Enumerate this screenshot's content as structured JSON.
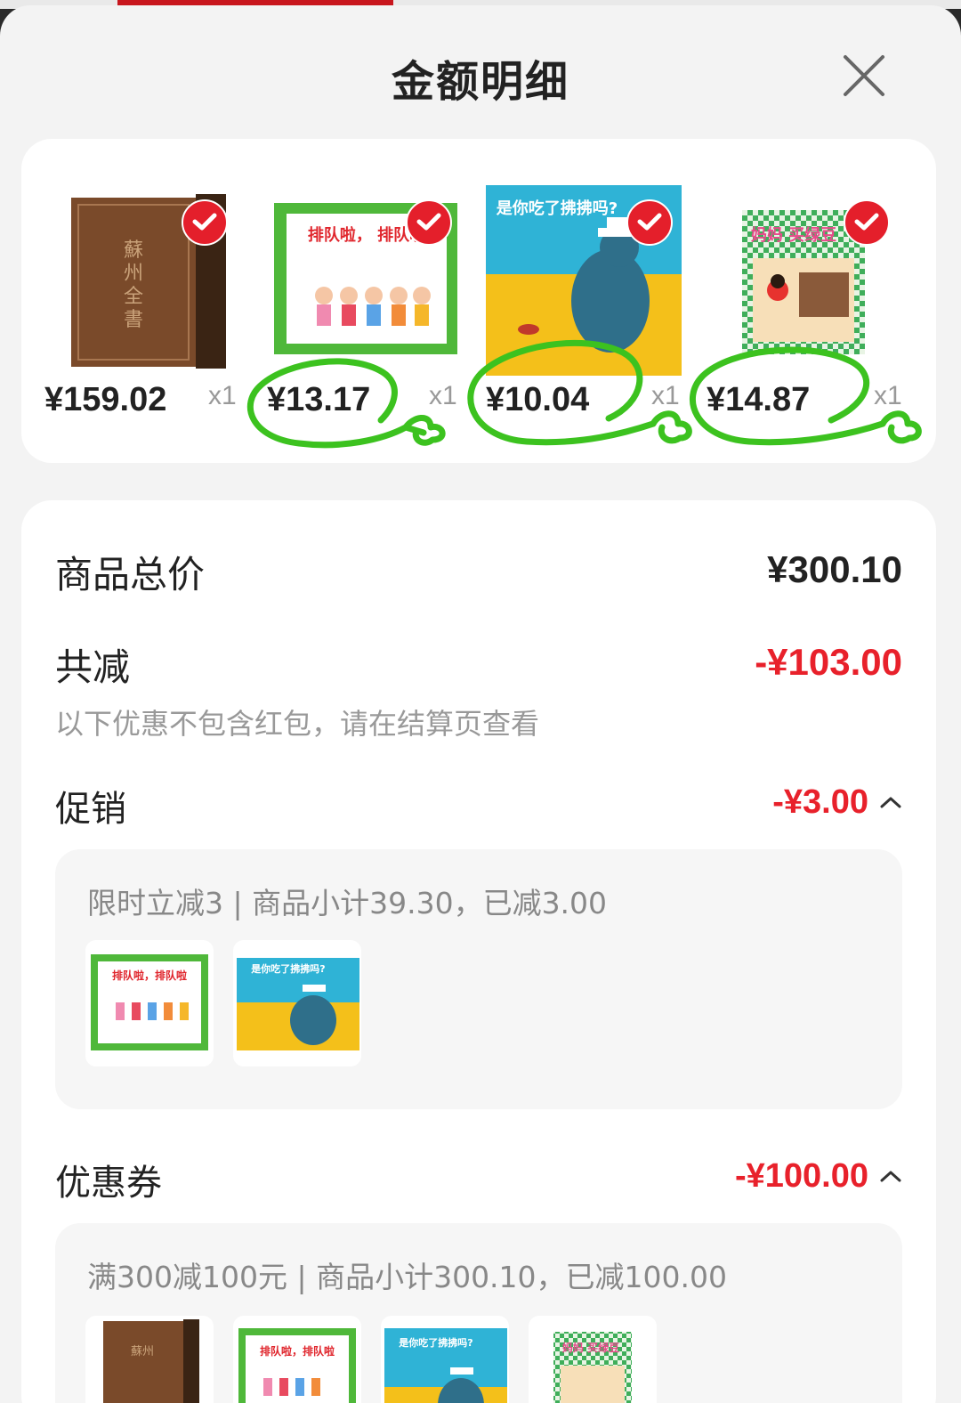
{
  "header": {
    "title": "金额明细",
    "close_icon": "close-icon"
  },
  "products": [
    {
      "name": "苏州全书",
      "price": "¥159.02",
      "qty": "x1",
      "selected": true,
      "cover_text": "蘇州全書"
    },
    {
      "name": "排队啦，排队啦",
      "price": "¥13.17",
      "qty": "x1",
      "selected": true,
      "cover_text": "排队啦，排队啦"
    },
    {
      "name": "是你吃了拂拂吗？",
      "price": "¥10.04",
      "qty": "x1",
      "selected": true,
      "cover_text": "是你吃了拂拂吗?"
    },
    {
      "name": "妈妈买绿豆",
      "price": "¥14.87",
      "qty": "x1",
      "selected": true,
      "cover_text": "妈妈 买绿豆"
    }
  ],
  "summary": {
    "total_label": "商品总价",
    "total_value": "¥300.10",
    "discount_label": "共减",
    "discount_value": "-¥103.00",
    "note": "以下优惠不包含红包，请在结算页查看"
  },
  "promotion": {
    "label": "促销",
    "value": "-¥3.00",
    "detail": "限时立减3 | 商品小计39.30，已减3.00"
  },
  "coupon": {
    "label": "优惠券",
    "value": "-¥100.00",
    "detail": "满300减100元 | 商品小计300.10，已减100.00"
  },
  "colors": {
    "accent_red": "#e8212b",
    "annotation_green": "#3cc21f"
  }
}
